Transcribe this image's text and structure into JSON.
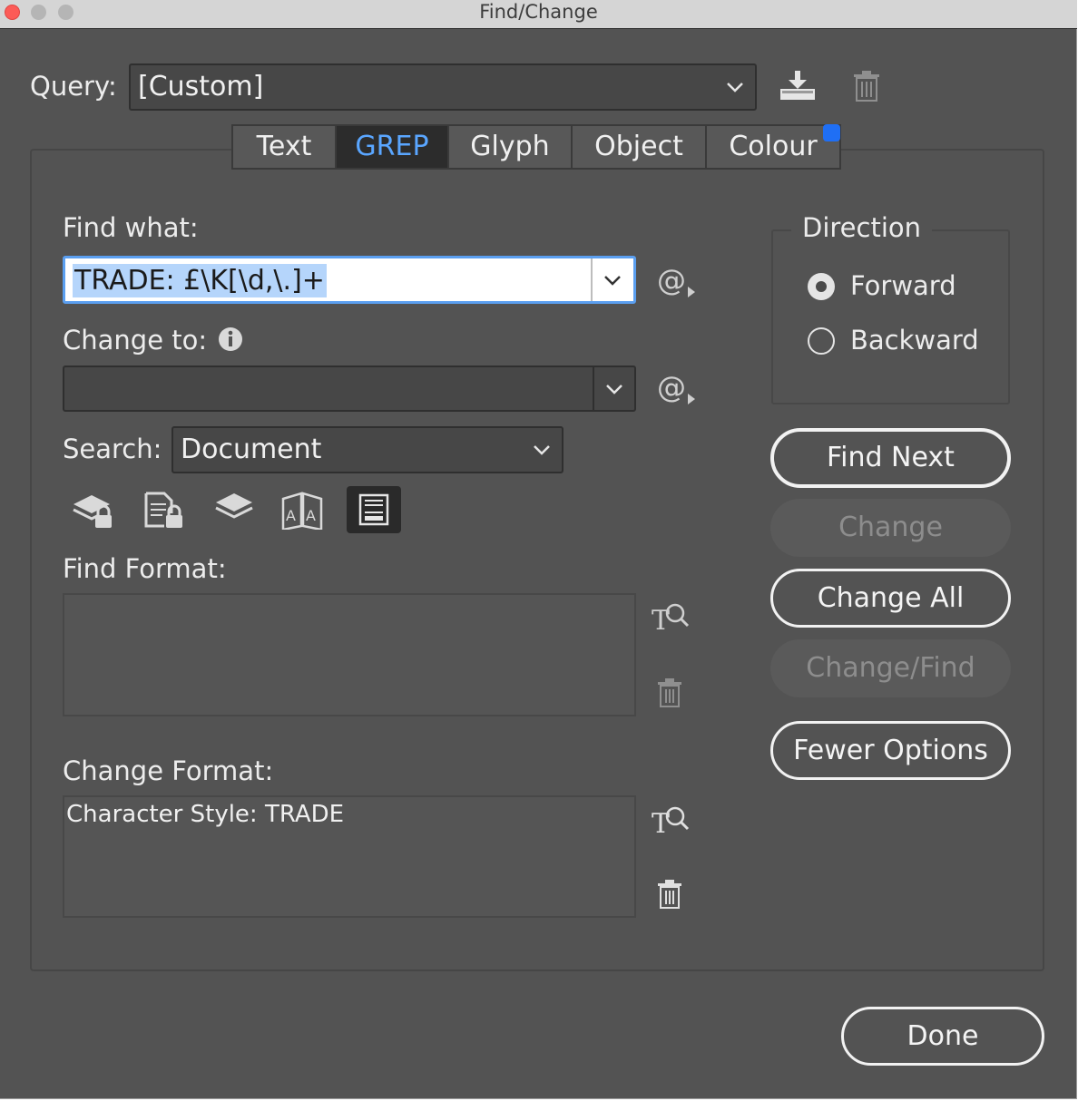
{
  "window": {
    "title": "Find/Change"
  },
  "query": {
    "label": "Query:",
    "value": "[Custom]"
  },
  "tabs": [
    "Text",
    "GREP",
    "Glyph",
    "Object",
    "Colour"
  ],
  "active_tab": "GREP",
  "find_what": {
    "label": "Find what:",
    "value": "TRADE: £\\K[\\d,\\.]+"
  },
  "change_to": {
    "label": "Change to:",
    "value": ""
  },
  "search": {
    "label": "Search:",
    "value": "Document"
  },
  "find_format": {
    "label": "Find Format:",
    "value": ""
  },
  "change_format": {
    "label": "Change Format:",
    "value": "Character Style: TRADE"
  },
  "direction": {
    "label": "Direction",
    "forward": "Forward",
    "backward": "Backward",
    "selected": "Forward"
  },
  "buttons": {
    "find_next": "Find Next",
    "change": "Change",
    "change_all": "Change All",
    "change_find": "Change/Find",
    "fewer_options": "Fewer Options",
    "done": "Done"
  },
  "colors": {
    "window_bg": "#535353",
    "accent": "#5aa6ff",
    "selection": "#b5d5fb",
    "badge": "#1f6ff5"
  },
  "icons": [
    "save-query-icon",
    "delete-query-icon",
    "special-characters-icon",
    "info-icon",
    "include-locked-layers-icon",
    "include-locked-stories-icon",
    "include-hidden-layers-icon",
    "include-master-pages-icon",
    "include-footnotes-icon",
    "specify-find-format-icon",
    "specify-change-format-icon",
    "trash-icon"
  ]
}
